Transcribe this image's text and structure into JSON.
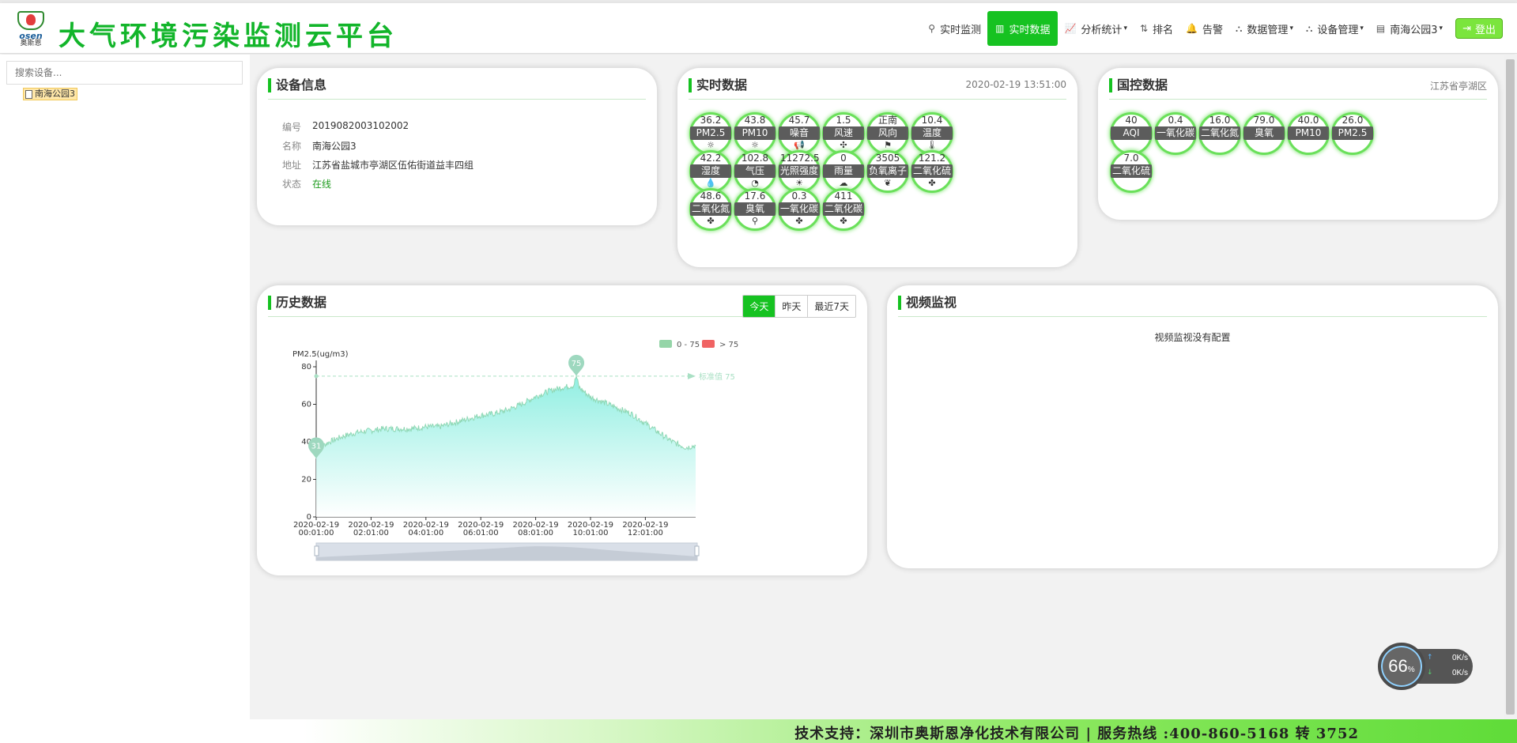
{
  "app": {
    "title": "大气环境污染监测云平台",
    "logo_brand": "osen",
    "logo_cn": "奥斯恩"
  },
  "nav": {
    "items": [
      {
        "label": "实时监测",
        "icon": "map-marker-icon"
      },
      {
        "label": "实时数据",
        "icon": "bar-chart-icon",
        "active": true
      },
      {
        "label": "分析统计",
        "icon": "line-chart-icon",
        "dropdown": true
      },
      {
        "label": "排名",
        "icon": "sort-icon"
      },
      {
        "label": "告警",
        "icon": "bell-icon"
      },
      {
        "label": "数据管理",
        "icon": "sitemap-icon",
        "dropdown": true
      },
      {
        "label": "设备管理",
        "icon": "sitemap-icon",
        "dropdown": true
      },
      {
        "label": "南海公园3",
        "icon": "id-card-icon",
        "dropdown": true
      }
    ],
    "logout": "登出"
  },
  "sidebar": {
    "search_placeholder": "搜索设备...",
    "tree": [
      {
        "label": "南海公园3",
        "selected": true
      }
    ]
  },
  "device_info": {
    "title": "设备信息",
    "rows": [
      {
        "key": "编号",
        "value": "2019082003102002"
      },
      {
        "key": "名称",
        "value": "南海公园3"
      },
      {
        "key": "地址",
        "value": "江苏省盐城市亭湖区伍佑街道益丰四组"
      },
      {
        "key": "状态",
        "value": "在线"
      }
    ]
  },
  "realtime": {
    "title": "实时数据",
    "timestamp": "2020-02-19 13:51:00",
    "gauges": [
      {
        "value": "36.2",
        "label": "PM2.5",
        "icon": "☼"
      },
      {
        "value": "43.8",
        "label": "PM10",
        "icon": "☼"
      },
      {
        "value": "45.7",
        "label": "噪音",
        "icon": "📢"
      },
      {
        "value": "1.5",
        "label": "风速",
        "icon": "✣"
      },
      {
        "value": "正南",
        "label": "风向",
        "icon": "⚑"
      },
      {
        "value": "10.4",
        "label": "温度",
        "icon": "🌡"
      },
      {
        "value": "42.2",
        "label": "湿度",
        "icon": "💧"
      },
      {
        "value": "102.8",
        "label": "气压",
        "icon": "◔"
      },
      {
        "value": "11272.5",
        "label": "光照强度",
        "icon": "☀"
      },
      {
        "value": "0",
        "label": "雨量",
        "icon": "☁"
      },
      {
        "value": "3505",
        "label": "负氧离子",
        "icon": "❦"
      },
      {
        "value": "121.2",
        "label": "二氧化硫",
        "icon": "✤"
      },
      {
        "value": "48.6",
        "label": "二氧化氮",
        "icon": "✤"
      },
      {
        "value": "17.6",
        "label": "臭氧",
        "icon": "⚲"
      },
      {
        "value": "0.3",
        "label": "一氧化碳",
        "icon": "✤"
      },
      {
        "value": "411",
        "label": "二氧化碳",
        "icon": "✤"
      }
    ]
  },
  "national": {
    "title": "国控数据",
    "region": "江苏省亭湖区",
    "gauges": [
      {
        "value": "40",
        "label": "AQI"
      },
      {
        "value": "0.4",
        "label": "一氧化碳"
      },
      {
        "value": "16.0",
        "label": "二氧化氮"
      },
      {
        "value": "79.0",
        "label": "臭氧"
      },
      {
        "value": "40.0",
        "label": "PM10"
      },
      {
        "value": "26.0",
        "label": "PM2.5"
      },
      {
        "value": "7.0",
        "label": "二氧化硫"
      }
    ]
  },
  "history": {
    "title": "历史数据",
    "ranges": [
      {
        "label": "今天",
        "active": true
      },
      {
        "label": "昨天"
      },
      {
        "label": "最近7天"
      }
    ]
  },
  "chart_data": {
    "type": "area",
    "ylabel": "PM2.5(ug/m3)",
    "ylim": [
      0,
      80
    ],
    "yticks": [
      0,
      20,
      40,
      60,
      80
    ],
    "xticks": [
      {
        "hour": 0.0167,
        "date": "2020-02-19",
        "time": "00:01:00"
      },
      {
        "hour": 2.0167,
        "date": "2020-02-19",
        "time": "02:01:00"
      },
      {
        "hour": 4.0167,
        "date": "2020-02-19",
        "time": "04:01:00"
      },
      {
        "hour": 6.0167,
        "date": "2020-02-19",
        "time": "06:01:00"
      },
      {
        "hour": 8.0167,
        "date": "2020-02-19",
        "time": "08:01:00"
      },
      {
        "hour": 10.0167,
        "date": "2020-02-19",
        "time": "10:01:00"
      },
      {
        "hour": 12.0167,
        "date": "2020-02-19",
        "time": "12:01:00"
      }
    ],
    "xlim_hours": [
      0.0167,
      13.85
    ],
    "series": [
      {
        "x_hours": [
          0.0167,
          0.5,
          1.0,
          1.5,
          2.0,
          2.5,
          3.0,
          3.5,
          4.0,
          4.5,
          5.0,
          5.5,
          6.0,
          6.5,
          7.0,
          7.5,
          8.0,
          8.5,
          9.0,
          9.4,
          9.5,
          9.6,
          10.0,
          10.5,
          11.0,
          11.5,
          12.0,
          12.5,
          13.0,
          13.5,
          13.85
        ],
        "values": [
          36,
          40,
          43,
          45,
          46,
          47,
          47,
          47,
          48,
          48,
          50,
          52,
          54,
          55,
          57,
          60,
          64,
          67,
          69,
          70,
          75,
          69,
          64,
          61,
          58,
          55,
          50,
          45,
          40,
          37,
          38
        ]
      }
    ],
    "markpoints": [
      {
        "x_hour": 0.0167,
        "value": 31,
        "label": "31"
      },
      {
        "x_hour": 9.5,
        "value": 75,
        "label": "75"
      }
    ],
    "markline": {
      "value": 75,
      "label": "标准值 75"
    },
    "visualmap": [
      {
        "label": "0 - 75",
        "color": "#95d5a8"
      },
      {
        "label": "> 75",
        "color": "#f06363"
      }
    ],
    "colors": {
      "line": "#8fd8b5",
      "area_top": "#7eecdd",
      "area_bottom": "#ffffff"
    }
  },
  "video": {
    "title": "视频监视",
    "empty": "视频监视没有配置"
  },
  "net_monitor": {
    "percent": "66",
    "percent_unit": "%",
    "upload": "0K/s",
    "download": "0K/s"
  },
  "footer": {
    "text": "技术支持：深圳市奥斯恩净化技术有限公司 | 服务热线 :400-860-5168 转 3752"
  }
}
